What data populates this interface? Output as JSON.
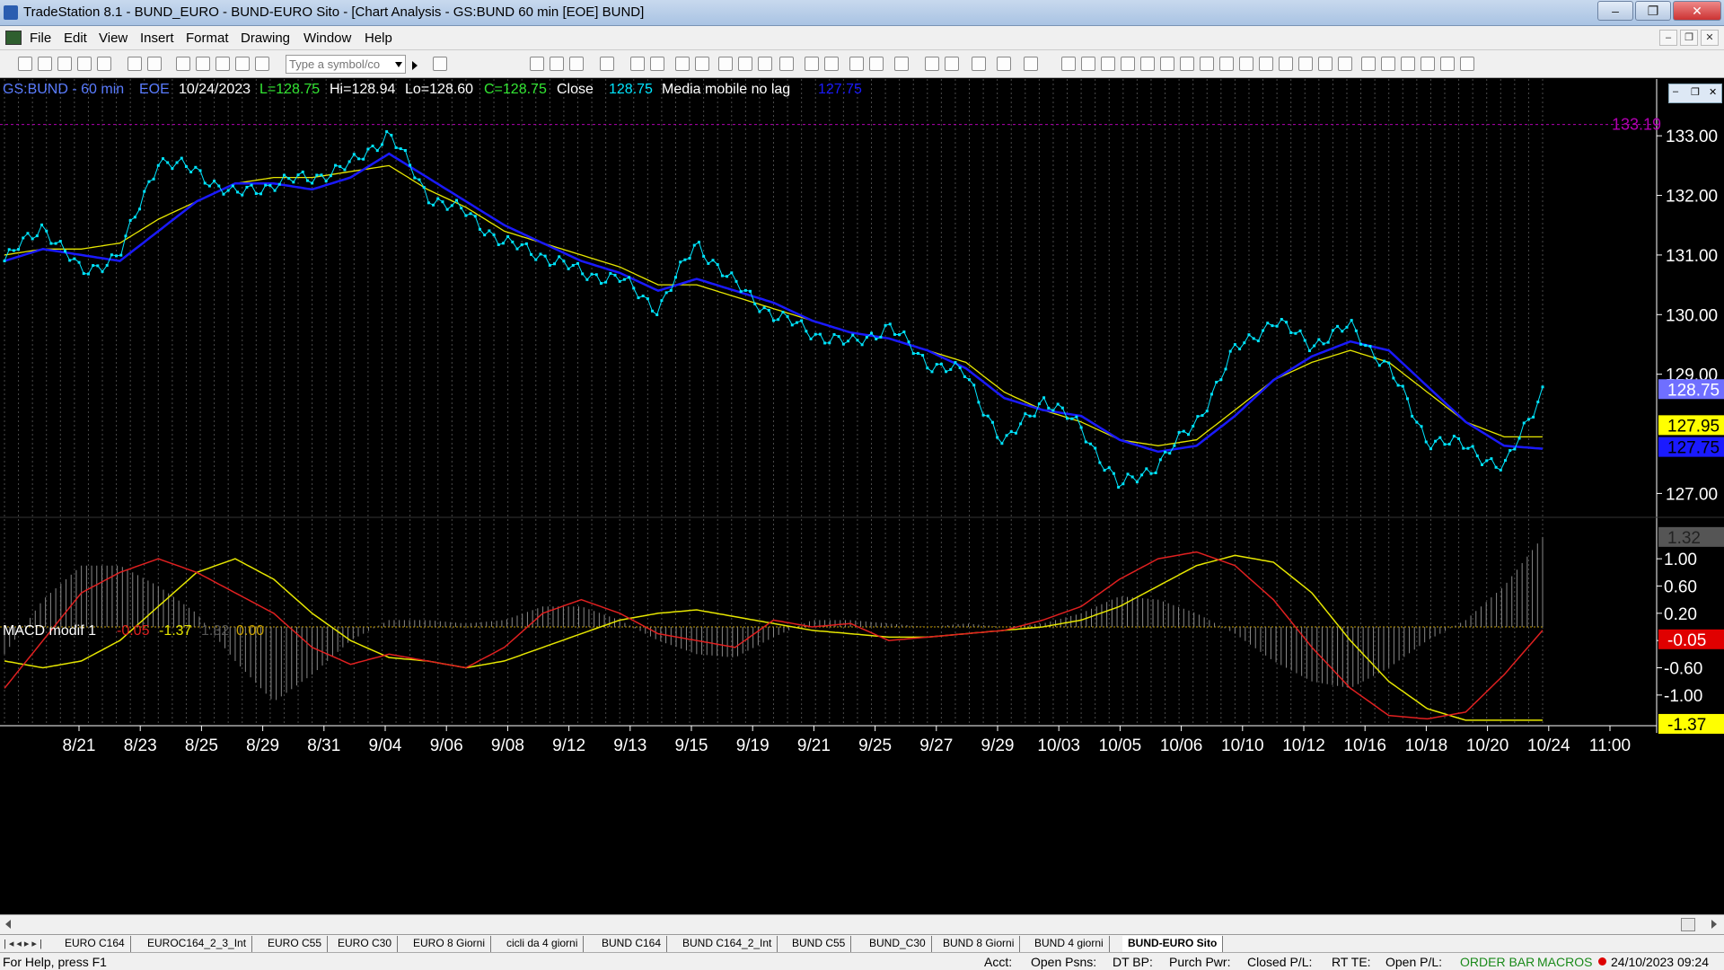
{
  "window": {
    "title": "TradeStation 8.1 - BUND_EURO - BUND-EURO Sito - [Chart Analysis - GS:BUND  60 min  [EOE] BUND]",
    "controls": [
      "–",
      "❐",
      "✕"
    ]
  },
  "menu": [
    "File",
    "Edit",
    "View",
    "Insert",
    "Format",
    "Drawing",
    "Window",
    "Help"
  ],
  "mdi_controls": [
    "–",
    "❐",
    "✕"
  ],
  "toolbar": {
    "symbol_placeholder": "Type a symbol/co"
  },
  "chart_header": {
    "symbol": "GS:BUND - 60 min",
    "session": "EOE",
    "date": "10/24/2023",
    "last": "L=128.75",
    "high": "Hi=128.94",
    "low": "Lo=128.60",
    "close": "C=128.75",
    "close_label": "Close",
    "close_value": "128.75",
    "indicator_label": "Media mobile no lag",
    "indicator_value": "127.75"
  },
  "macd_header": {
    "label": "MACD modif 1",
    "v1": "-0.05",
    "v2": "-1.37",
    "v3": "1.32",
    "v4": "0.00"
  },
  "price_badges": {
    "high_line": "133.19",
    "last": "128.75",
    "yellow_avg": "127.95",
    "blue_avg": "127.75"
  },
  "macd_badges": {
    "hist": "1.32",
    "red": "-0.05",
    "yellow": "-1.37"
  },
  "colors": {
    "price": "#00e5ff",
    "blue_avg": "#1a1aff",
    "yellow_avg": "#e6e600",
    "macd_red": "#e02020",
    "macd_yellow": "#e6e600",
    "hist": "#888888",
    "high_line": "#b000b0"
  },
  "chart_data": [
    {
      "type": "line",
      "title": "GS:BUND - 60 min",
      "y_ticks": [
        "133.00",
        "132.00",
        "131.00",
        "130.00",
        "129.00",
        "127.00"
      ],
      "ylim": [
        126.75,
        133.5
      ],
      "x_ticks": [
        "8/21",
        "8/23",
        "8/25",
        "8/29",
        "8/31",
        "9/04",
        "9/06",
        "9/08",
        "9/12",
        "9/13",
        "9/15",
        "9/19",
        "9/21",
        "9/25",
        "9/27",
        "9/29",
        "10/03",
        "10/05",
        "10/06",
        "10/10",
        "10/12",
        "10/16",
        "10/18",
        "10/20",
        "10/24",
        "11:00"
      ],
      "series": [
        {
          "name": "Close",
          "values": [
            130.9,
            131.5,
            130.7,
            131.0,
            132.6,
            132.4,
            132.0,
            132.2,
            132.3,
            132.5,
            133.05,
            132.0,
            131.7,
            131.2,
            131.0,
            130.7,
            130.6,
            130.1,
            131.2,
            130.5,
            130.0,
            129.7,
            129.5,
            129.8,
            129.2,
            129.0,
            127.8,
            128.6,
            128.1,
            127.1,
            127.5,
            128.2,
            129.4,
            129.9,
            129.5,
            129.8,
            129.1,
            127.9,
            127.8,
            127.4,
            128.75
          ]
        },
        {
          "name": "Media mobile no lag",
          "values": [
            130.9,
            131.1,
            131.0,
            130.9,
            131.4,
            131.9,
            132.2,
            132.2,
            132.1,
            132.3,
            132.7,
            132.3,
            131.9,
            131.5,
            131.2,
            130.9,
            130.7,
            130.4,
            130.6,
            130.4,
            130.2,
            129.9,
            129.7,
            129.6,
            129.4,
            129.1,
            128.6,
            128.4,
            128.3,
            127.9,
            127.7,
            127.8,
            128.3,
            128.9,
            129.3,
            129.55,
            129.4,
            128.8,
            128.2,
            127.8,
            127.75
          ]
        },
        {
          "name": "",
          "values": [
            131.0,
            131.1,
            131.1,
            131.2,
            131.6,
            131.9,
            132.2,
            132.3,
            132.3,
            132.4,
            132.5,
            132.1,
            131.8,
            131.4,
            131.2,
            131.0,
            130.8,
            130.5,
            130.5,
            130.3,
            130.1,
            129.9,
            129.7,
            129.6,
            129.4,
            129.2,
            128.7,
            128.4,
            128.2,
            127.9,
            127.8,
            127.9,
            128.4,
            128.9,
            129.2,
            129.4,
            129.2,
            128.7,
            128.2,
            127.95,
            127.95
          ]
        }
      ]
    },
    {
      "type": "line",
      "title": "MACD modif 1",
      "y_ticks": [
        "1.00",
        "0.60",
        "0.20",
        "-0.20",
        "-0.60",
        "-1.00"
      ],
      "ylim": [
        -1.45,
        1.45
      ],
      "series": [
        {
          "name": "",
          "values": [
            -0.9,
            -0.2,
            0.5,
            0.8,
            1.0,
            0.8,
            0.5,
            0.2,
            -0.3,
            -0.55,
            -0.4,
            -0.5,
            -0.6,
            -0.3,
            0.2,
            0.4,
            0.2,
            -0.1,
            -0.2,
            -0.3,
            0.1,
            0.0,
            0.05,
            -0.2,
            -0.15,
            -0.1,
            -0.05,
            0.1,
            0.3,
            0.7,
            1.0,
            1.1,
            0.9,
            0.4,
            -0.3,
            -0.9,
            -1.3,
            -1.35,
            -1.25,
            -0.7,
            -0.05
          ]
        },
        {
          "name": "",
          "values": [
            -0.5,
            -0.6,
            -0.5,
            -0.2,
            0.3,
            0.8,
            1.0,
            0.7,
            0.2,
            -0.2,
            -0.45,
            -0.5,
            -0.6,
            -0.5,
            -0.3,
            -0.1,
            0.1,
            0.2,
            0.25,
            0.15,
            0.05,
            -0.05,
            -0.1,
            -0.15,
            -0.15,
            -0.1,
            -0.05,
            0.0,
            0.1,
            0.3,
            0.6,
            0.9,
            1.05,
            0.95,
            0.5,
            -0.2,
            -0.8,
            -1.2,
            -1.37,
            -1.37,
            -1.37
          ]
        },
        {
          "name": "",
          "values": [
            -0.4,
            0.4,
            0.9,
            0.9,
            0.6,
            0.2,
            -0.5,
            -1.1,
            -0.7,
            -0.2,
            0.1,
            0.1,
            0.05,
            0.1,
            0.3,
            0.3,
            0.1,
            -0.2,
            -0.4,
            -0.45,
            -0.15,
            0.1,
            0.1,
            0.05,
            0.0,
            0.05,
            0.0,
            0.05,
            0.2,
            0.45,
            0.4,
            0.2,
            -0.1,
            -0.5,
            -0.8,
            -0.9,
            -0.6,
            -0.2,
            0.1,
            0.6,
            1.32
          ]
        }
      ]
    }
  ],
  "sheet_tabs": [
    "EURO C164",
    "EUROC164_2_3_Int",
    "EURO C55",
    "EURO C30",
    "EURO 8 Giorni",
    "cicli da 4 giorni",
    "BUND C164",
    "BUND C164_2_Int",
    "BUND C55",
    "BUND_C30",
    "BUND 8 Giorni",
    "BUND 4 giorni",
    "BUND-EURO Sito"
  ],
  "status": {
    "help": "For Help, press F1",
    "acct": "Acct:",
    "open_psns": "Open Psns:",
    "dt_bp": "DT BP:",
    "purch_pwr": "Purch Pwr:",
    "closed_pl": "Closed P/L:",
    "rt_te": "RT TE:",
    "open_pl": "Open P/L:",
    "order_bar": "ORDER BAR",
    "macros": "MACROS",
    "datetime": "24/10/2023 09:24"
  }
}
